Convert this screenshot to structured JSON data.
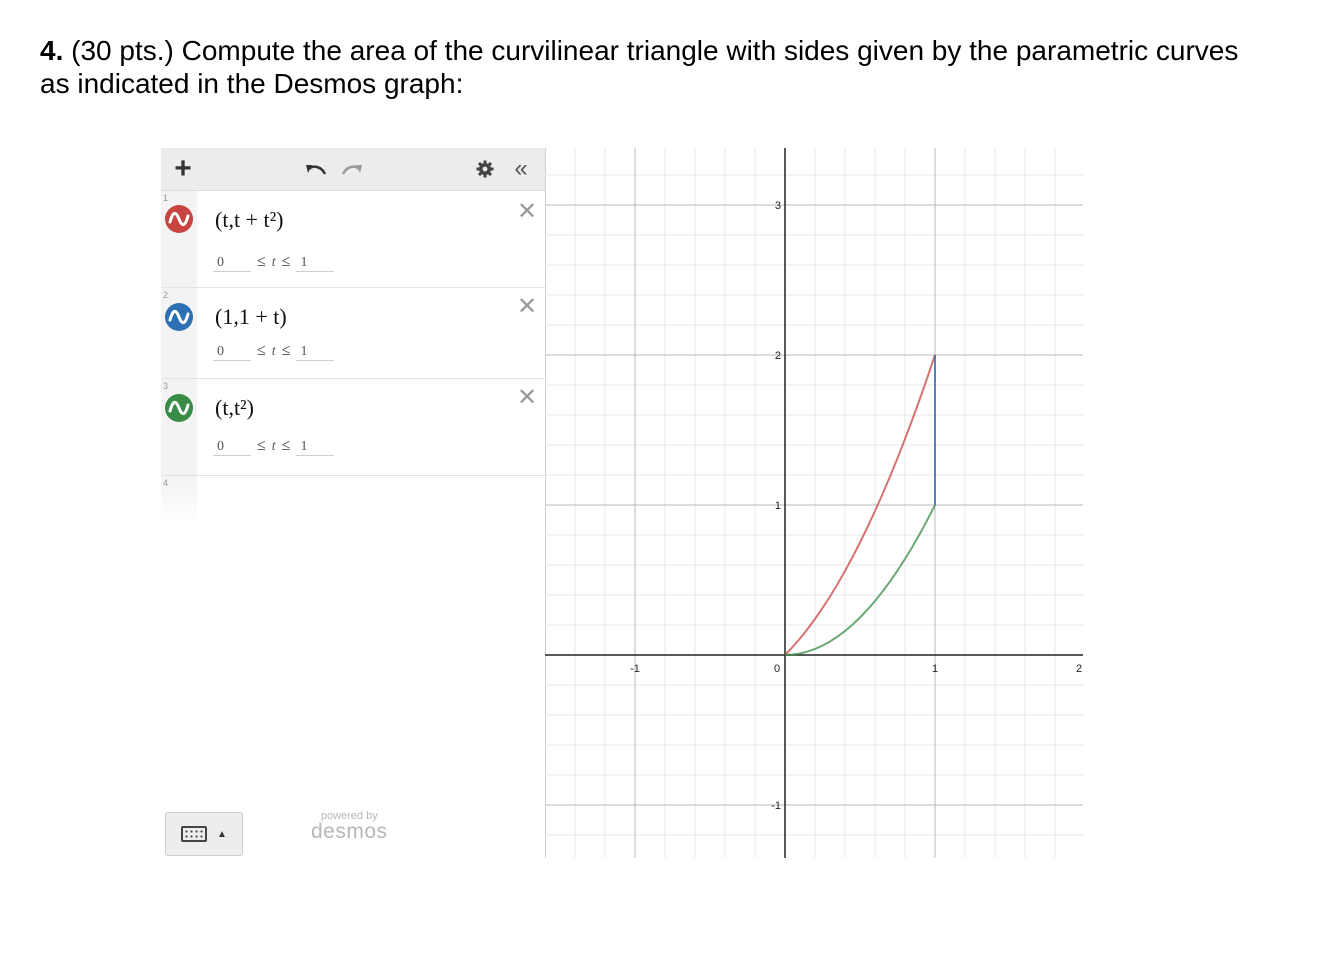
{
  "question": {
    "number": "4.",
    "text": "(30 pts.) Compute the area of the curvilinear triangle with sides given by the parametric curves as indicated in the Desmos graph:"
  },
  "desmos": {
    "toolbar": {
      "add_icon": "plus-icon",
      "undo_icon": "undo-icon",
      "redo_icon": "redo-icon",
      "settings_icon": "gear-icon",
      "collapse_icon": "double-chevron-left-icon"
    },
    "expressions": [
      {
        "index": "1",
        "latex": "(t,t + t²)",
        "color": "#c74440",
        "min": "0",
        "max": "1",
        "bound_var": "t"
      },
      {
        "index": "2",
        "latex": "(1,1 + t)",
        "color": "#2d70b3",
        "min": "0",
        "max": "1",
        "bound_var": "t"
      },
      {
        "index": "3",
        "latex": "(t,t²)",
        "color": "#388c46",
        "min": "0",
        "max": "1",
        "bound_var": "t"
      },
      {
        "index": "4"
      }
    ],
    "keyboard_icon": "keyboard-icon",
    "powered_by": "powered by",
    "brand": "desmos",
    "graph": {
      "x_ticks": [
        "-1",
        "0",
        "1",
        "2"
      ],
      "y_ticks": [
        "3",
        "2",
        "1",
        "-1"
      ]
    }
  }
}
